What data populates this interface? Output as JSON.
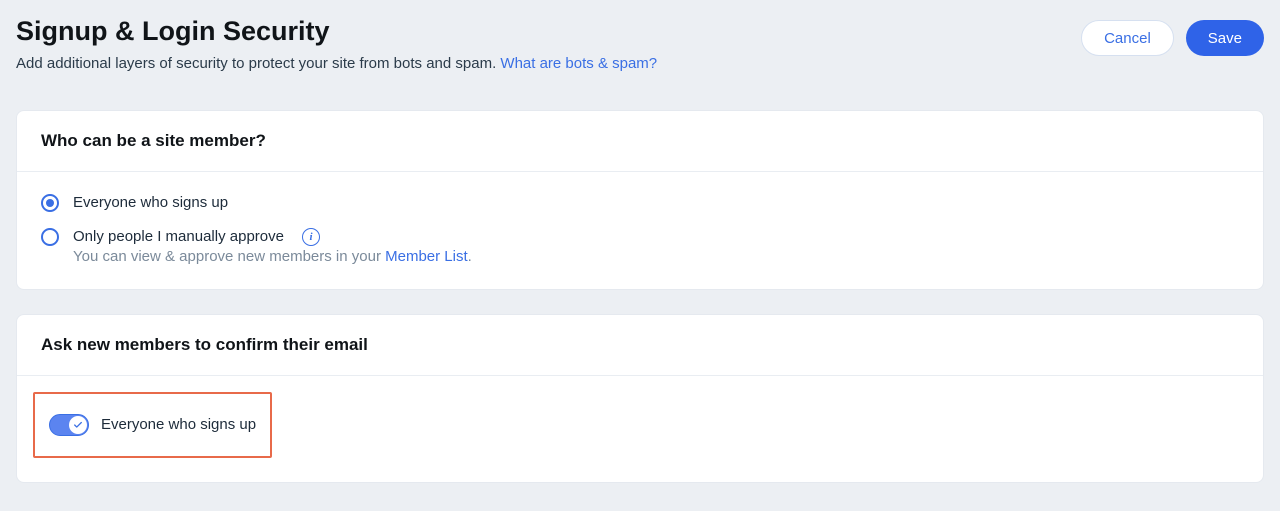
{
  "header": {
    "title": "Signup & Login Security",
    "subtitle_plain": "Add additional layers of security to protect your site from bots and spam. ",
    "subtitle_link": "What are bots & spam?",
    "cancel_label": "Cancel",
    "save_label": "Save"
  },
  "membership": {
    "card_title": "Who can be a site member?",
    "option_everyone": "Everyone who signs up",
    "option_manual": "Only people I manually approve",
    "info_glyph": "i",
    "helper_prefix": "You can view & approve new members in your ",
    "helper_link": "Member List",
    "helper_suffix": "."
  },
  "confirm": {
    "card_title": "Ask new members to confirm their email",
    "toggle_label": "Everyone who signs up"
  }
}
